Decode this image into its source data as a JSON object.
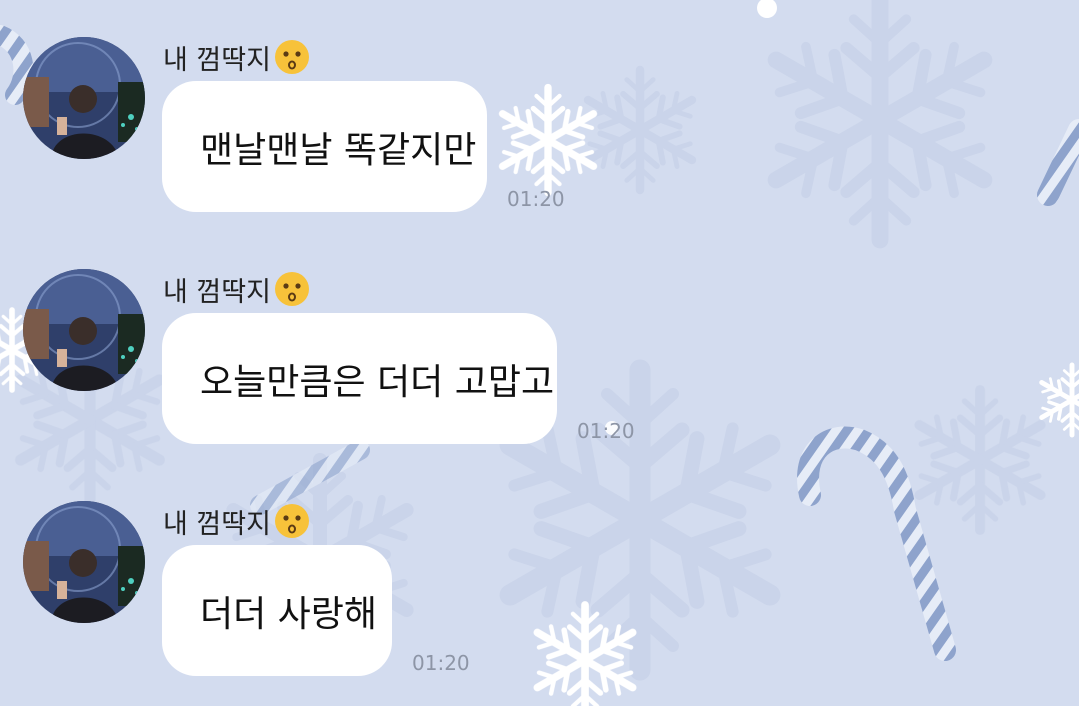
{
  "chat": {
    "messages": [
      {
        "sender": "내 껌딱지",
        "sender_emoji": "kissing-face-emoji",
        "text": "맨날맨날 똑같지만",
        "time": "01:20"
      },
      {
        "sender": "내 껌딱지",
        "sender_emoji": "kissing-face-emoji",
        "text": "오늘만큼은 더더 고맙고",
        "time": "01:20"
      },
      {
        "sender": "내 껌딱지",
        "sender_emoji": "kissing-face-emoji",
        "text": "더더 사랑해",
        "time": "01:20"
      }
    ]
  },
  "theme": {
    "background": "#d3dcef",
    "bubble": "#ffffff",
    "time_color": "#8d95a6",
    "background_decoration": [
      "snowflake-icon",
      "candy-cane-icon"
    ]
  }
}
